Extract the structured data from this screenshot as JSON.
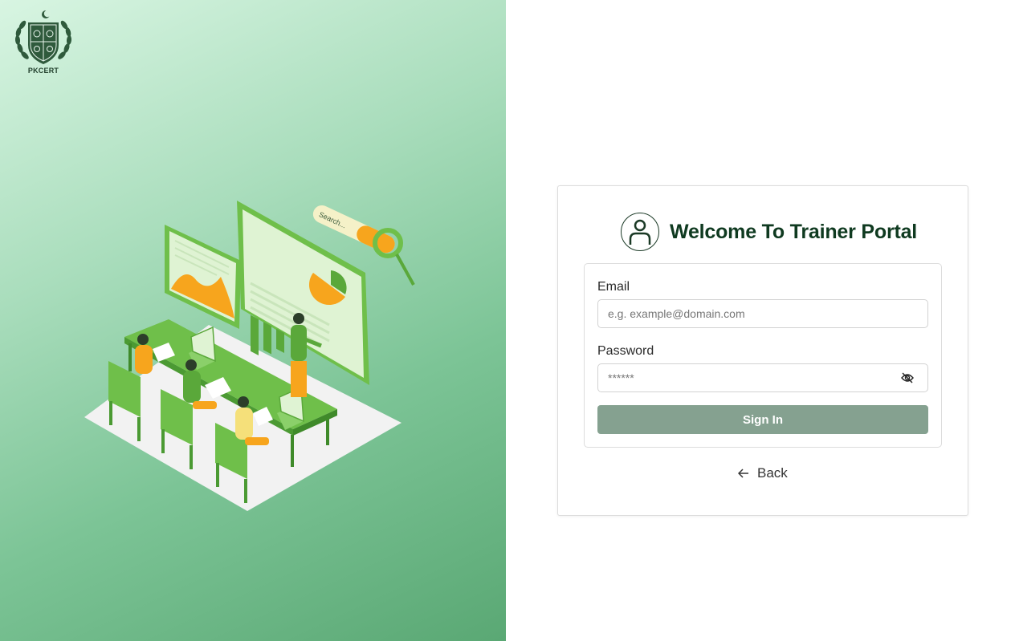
{
  "brand": {
    "logo_text": "PKCERT",
    "accent_color": "#0f3a20",
    "panel_gradient": [
      "#d8f5e2",
      "#5aa874"
    ]
  },
  "illustration": {
    "search_text": "Search..."
  },
  "login": {
    "title": "Welcome To Trainer Portal",
    "title_icon": "user-icon",
    "email": {
      "label": "Email",
      "placeholder": "e.g. example@domain.com",
      "value": ""
    },
    "password": {
      "label": "Password",
      "placeholder": "******",
      "value": "",
      "toggle_icon": "eye-off-icon"
    },
    "submit_label": "Sign In",
    "submit_color": "#85a190",
    "back_label": "Back",
    "back_icon": "arrow-left-icon"
  }
}
